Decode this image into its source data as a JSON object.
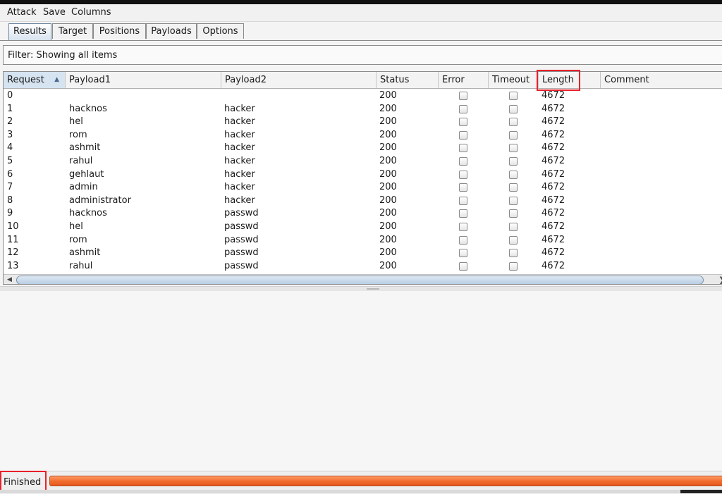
{
  "menu": {
    "items": [
      "Attack",
      "Save",
      "Columns"
    ]
  },
  "tabs": [
    "Results",
    "Target",
    "Positions",
    "Payloads",
    "Options"
  ],
  "active_tab": "Results",
  "filter": {
    "text": "Filter: Showing all items"
  },
  "table": {
    "columns": [
      "Request",
      "Payload1",
      "Payload2",
      "Status",
      "Error",
      "Timeout",
      "Length",
      "Comment"
    ],
    "sorted_column": "Request",
    "rows": [
      {
        "request": "0",
        "payload1": "",
        "payload2": "",
        "status": "200",
        "length": "4672"
      },
      {
        "request": "1",
        "payload1": "hacknos",
        "payload2": "hacker",
        "status": "200",
        "length": "4672"
      },
      {
        "request": "2",
        "payload1": "hel",
        "payload2": "hacker",
        "status": "200",
        "length": "4672"
      },
      {
        "request": "3",
        "payload1": "rom",
        "payload2": "hacker",
        "status": "200",
        "length": "4672"
      },
      {
        "request": "4",
        "payload1": "ashmit",
        "payload2": "hacker",
        "status": "200",
        "length": "4672"
      },
      {
        "request": "5",
        "payload1": "rahul",
        "payload2": "hacker",
        "status": "200",
        "length": "4672"
      },
      {
        "request": "6",
        "payload1": "gehlaut",
        "payload2": "hacker",
        "status": "200",
        "length": "4672"
      },
      {
        "request": "7",
        "payload1": "admin",
        "payload2": "hacker",
        "status": "200",
        "length": "4672"
      },
      {
        "request": "8",
        "payload1": "administrator",
        "payload2": "hacker",
        "status": "200",
        "length": "4672"
      },
      {
        "request": "9",
        "payload1": "hacknos",
        "payload2": "passwd",
        "status": "200",
        "length": "4672"
      },
      {
        "request": "10",
        "payload1": "hel",
        "payload2": "passwd",
        "status": "200",
        "length": "4672"
      },
      {
        "request": "11",
        "payload1": "rom",
        "payload2": "passwd",
        "status": "200",
        "length": "4672"
      },
      {
        "request": "12",
        "payload1": "ashmit",
        "payload2": "passwd",
        "status": "200",
        "length": "4672"
      },
      {
        "request": "13",
        "payload1": "rahul",
        "payload2": "passwd",
        "status": "200",
        "length": "4672"
      }
    ]
  },
  "status": {
    "text": "Finished",
    "progress_fraction": 1.0
  },
  "colors": {
    "highlight_box": "#e8202a",
    "progress_bar": "#f06a2e",
    "sorted_header": "#d6e4f2"
  }
}
